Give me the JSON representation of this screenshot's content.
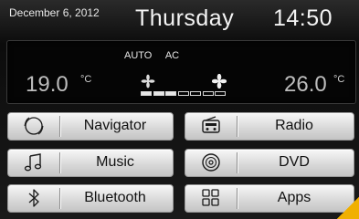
{
  "header": {
    "date": "December 6, 2012",
    "day": "Thursday",
    "time": "14:50"
  },
  "climate": {
    "modes": [
      "AUTO",
      "AC"
    ],
    "left_temp": "19.0",
    "right_temp": "26.0",
    "unit": "°C",
    "fan_level": 3,
    "fan_max": 7
  },
  "buttons": {
    "navigator": {
      "label": "Navigator",
      "icon": "compass-icon"
    },
    "radio": {
      "label": "Radio",
      "icon": "radio-icon"
    },
    "music": {
      "label": "Music",
      "icon": "music-note-icon"
    },
    "dvd": {
      "label": "DVD",
      "icon": "disc-icon"
    },
    "bluetooth": {
      "label": "Bluetooth",
      "icon": "bluetooth-icon"
    },
    "apps": {
      "label": "Apps",
      "icon": "apps-grid-icon"
    }
  },
  "colors": {
    "accent": "#f0b000",
    "background": "#101010",
    "button": "#d9d9d9"
  }
}
